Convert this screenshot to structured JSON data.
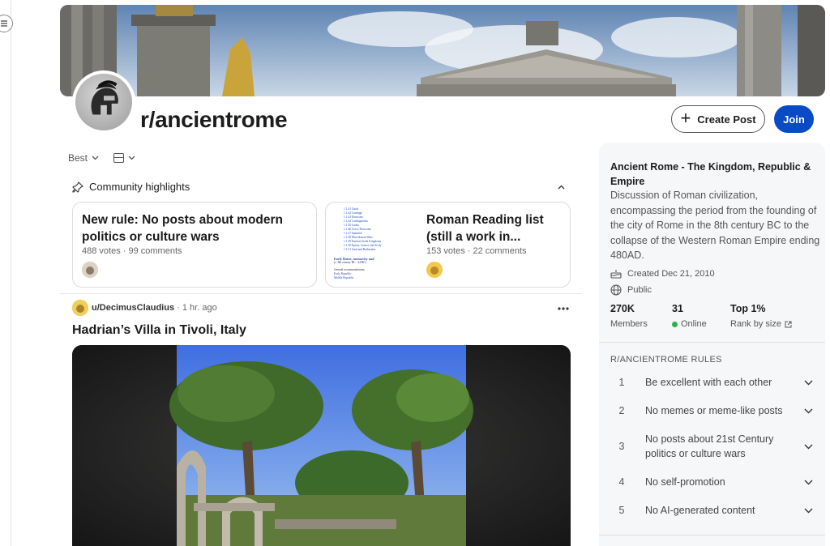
{
  "subreddit": {
    "name": "r/ancientrome",
    "create_post_label": "Create Post",
    "join_label": "Join"
  },
  "sort": {
    "selected": "Best"
  },
  "highlights": {
    "header": "Community highlights",
    "cards": [
      {
        "title": "New rule: No posts about modern politics or culture wars",
        "meta": "488 votes · 99 comments"
      },
      {
        "title": "Roman Reading list (still a work in...",
        "meta": "153 votes · 22 comments",
        "thumb_lines": [
          "1.1.41 Gauls",
          "1.1.42 Carthage",
          "1.1.43 Etruscans",
          "1.1.44 Carthaginians",
          "1.1.45 Latins",
          "1.1.46 Greco-Etruscans",
          "1.1.47 Samnites",
          "1.1.48 Macedonian Wars",
          "1.1.49 Eastern Greek Kingdoms",
          "1.1.50 Epirus, Greece and Sicily",
          "1.1.51 Gaul and Barbarians"
        ],
        "thumb_heading": "Early Rome, monarchy and",
        "thumb_sub": "(c. 8th century BC - 44 BC)",
        "thumb_general": "General recommendations",
        "thumb_link1": "Early Republic",
        "thumb_link2": "Middle Republic"
      }
    ]
  },
  "post": {
    "user": "u/DecimusClaudius",
    "time": "1 hr. ago",
    "title": "Hadrian’s Villa in Tivoli, Italy"
  },
  "sidebar": {
    "title": "Ancient Rome - The Kingdom, Republic & Empire",
    "description": "Discussion of Roman civilization, encompassing the period from the founding of the city of Rome in the 8th century BC to the collapse of the Western Roman Empire ending 480AD.",
    "created": "Created Dec 21, 2010",
    "visibility": "Public",
    "stats": [
      {
        "value": "270K",
        "label": "Members"
      },
      {
        "value": "31",
        "label": "Online"
      },
      {
        "value": "Top 1%",
        "label": "Rank by size"
      }
    ],
    "rules_header": "R/ANCIENTROME RULES",
    "rules": [
      {
        "num": "1",
        "text": "Be excellent with each other"
      },
      {
        "num": "2",
        "text": "No memes or meme-like posts"
      },
      {
        "num": "3",
        "text": "No posts about 21st Century politics or culture wars"
      },
      {
        "num": "4",
        "text": "No self-promotion"
      },
      {
        "num": "5",
        "text": "No AI-generated content"
      }
    ]
  },
  "colors": {
    "join": "#0a4ac6",
    "online": "#2bb24c"
  }
}
